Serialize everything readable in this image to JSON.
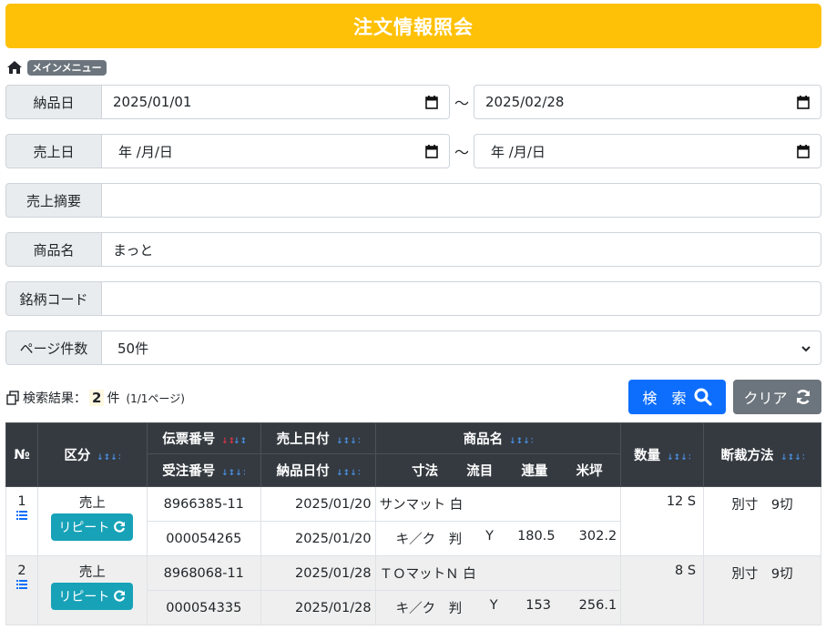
{
  "header": {
    "title": "注文情報照会"
  },
  "breadcrumb": {
    "menu_label": "メインメニュー"
  },
  "form": {
    "delivery_date": {
      "label": "納品日",
      "from": "2025/01/01",
      "to": "2025/02/28",
      "separator": "～"
    },
    "sales_date": {
      "label": "売上日",
      "from": "年 /月/日",
      "to": "年 /月/日",
      "separator": "～"
    },
    "sales_summary": {
      "label": "売上摘要",
      "value": ""
    },
    "product_name": {
      "label": "商品名",
      "value": "まっと"
    },
    "brand_code": {
      "label": "銘柄コード",
      "value": ""
    },
    "page_size": {
      "label": "ページ件数",
      "value": "50件"
    }
  },
  "result": {
    "label": "検索結果：",
    "count": "2",
    "unit": "件",
    "page_info": "(1/1ページ)"
  },
  "buttons": {
    "search": "検　索",
    "clear": "クリア"
  },
  "table": {
    "headers": {
      "no": "№",
      "category": "区分",
      "slip_no": "伝票番号",
      "order_no": "受注番号",
      "sales_date": "売上日付",
      "delivery_date": "納品日付",
      "product_name": "商品名",
      "size": "寸法",
      "grain": "流目",
      "ream_weight": "連量",
      "basis_weight": "米坪",
      "quantity": "数量",
      "cutting": "断裁方法"
    },
    "rows": [
      {
        "no": "1",
        "category": "売上",
        "repeat_label": "リピート",
        "slip_no": "8966385-11",
        "order_no": "000054265",
        "sales_date": "2025/01/20",
        "delivery_date": "2025/01/20",
        "product_name": "サンマット 白",
        "size": "キ／ク　判",
        "grain": "Y",
        "ream_weight": "180.5",
        "basis_weight": "302.2",
        "quantity": "12 S",
        "cutting": "別寸　9切"
      },
      {
        "no": "2",
        "category": "売上",
        "repeat_label": "リピート",
        "slip_no": "8968068-11",
        "order_no": "000054335",
        "sales_date": "2025/01/28",
        "delivery_date": "2025/01/28",
        "product_name": "ＴＯマットＮ 白",
        "size": "キ／ク　判",
        "grain": "Y",
        "ream_weight": "153",
        "basis_weight": "256.1",
        "quantity": "8 S",
        "cutting": "別寸　9切"
      }
    ]
  },
  "colors": {
    "title_bg": "#ffc107",
    "search_btn": "#0d6efd",
    "clear_btn": "#6c757d",
    "repeat_btn": "#17a2b8",
    "table_header": "#343a40",
    "sort_active": "#dc3545",
    "sort_inactive": "#4a90e2"
  },
  "icons": [
    "home-icon",
    "calendar-icon",
    "chevron-down-icon",
    "copy-icon",
    "search-icon",
    "refresh-icon",
    "list-icon",
    "sort-icon"
  ]
}
